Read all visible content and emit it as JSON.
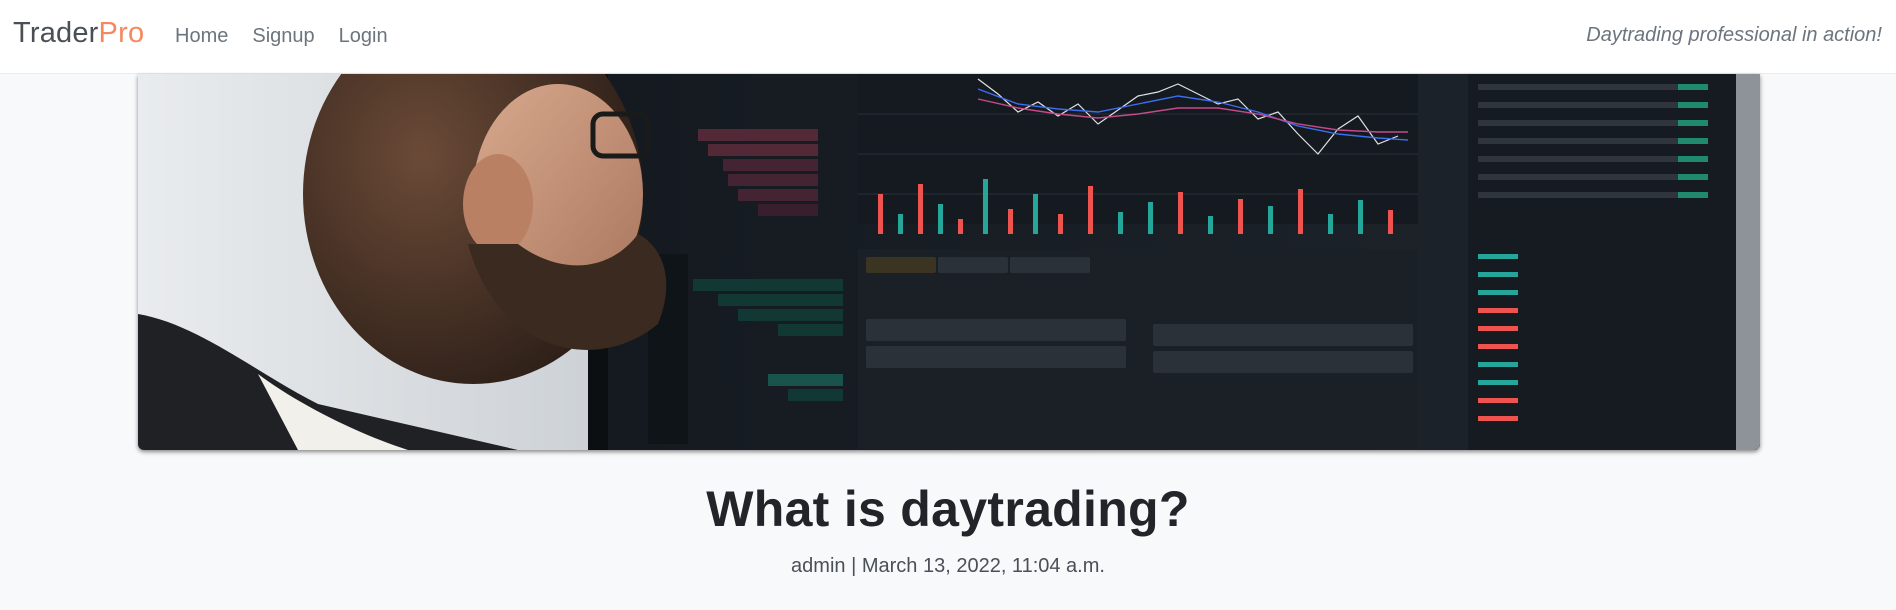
{
  "navbar": {
    "brand_prefix": "Trader",
    "brand_suffix": "Pro",
    "links": [
      {
        "label": "Home"
      },
      {
        "label": "Signup"
      },
      {
        "label": "Login"
      }
    ],
    "tagline": "Daytrading professional in action!"
  },
  "hero": {
    "image_alt": "Man looking at trading screen"
  },
  "post": {
    "title": "What is daytrading?",
    "author": "admin",
    "separator": "|",
    "date": "March 13, 2022, 11:04 a.m."
  },
  "colors": {
    "brand_accent": "#f4895f",
    "page_background": "#f8f9fa",
    "up": "#26a69a",
    "down": "#ef5350"
  }
}
